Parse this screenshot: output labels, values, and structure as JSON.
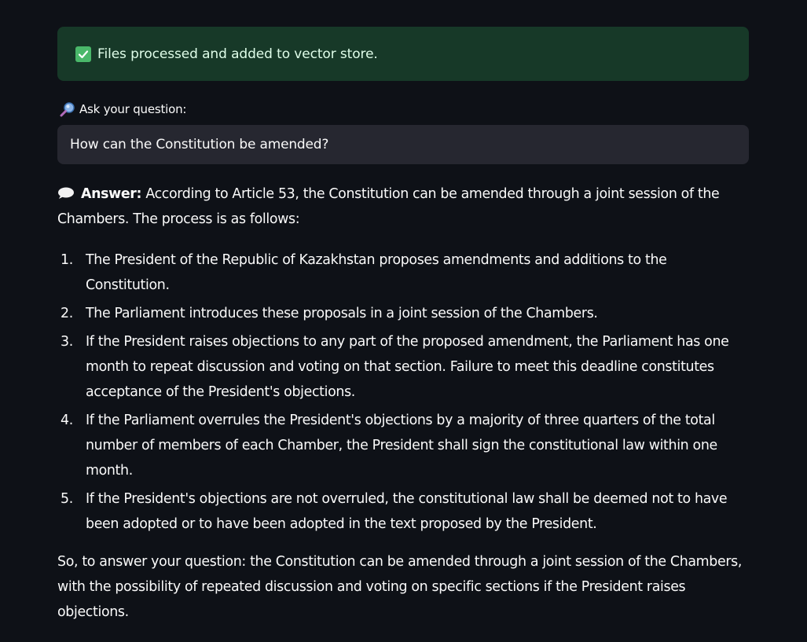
{
  "success_message": {
    "icon": "check-box-icon",
    "text": "Files processed and added to vector store.",
    "background": "#173928",
    "accent": "#4ab86a"
  },
  "question": {
    "icon": "magnifier-icon",
    "label": "Ask your question:",
    "value": "How can the Constitution be amended?"
  },
  "answer": {
    "icon": "speech-bubble-icon",
    "prefix": "Answer:",
    "intro": "According to Article 53, the Constitution can be amended through a joint session of the Chambers. The process is as follows:",
    "steps": [
      {
        "number": "1.",
        "text": "The President of the Republic of Kazakhstan proposes amendments and additions to the Constitution."
      },
      {
        "number": "2.",
        "text": "The Parliament introduces these proposals in a joint session of the Chambers."
      },
      {
        "number": "3.",
        "text": "If the President raises objections to any part of the proposed amendment, the Parliament has one month to repeat discussion and voting on that section. Failure to meet this deadline constitutes acceptance of the President's objections."
      },
      {
        "number": "4.",
        "text": "If the Parliament overrules the President's objections by a majority of three quarters of the total number of members of each Chamber, the President shall sign the constitutional law within one month."
      },
      {
        "number": "5.",
        "text": "If the President's objections are not overruled, the constitutional law shall be deemed not to have been adopted or to have been adopted in the text proposed by the President."
      }
    ],
    "conclusion": "So, to answer your question: the Constitution can be amended through a joint session of the Chambers, with the possibility of repeated discussion and voting on specific sections if the President raises objections."
  }
}
